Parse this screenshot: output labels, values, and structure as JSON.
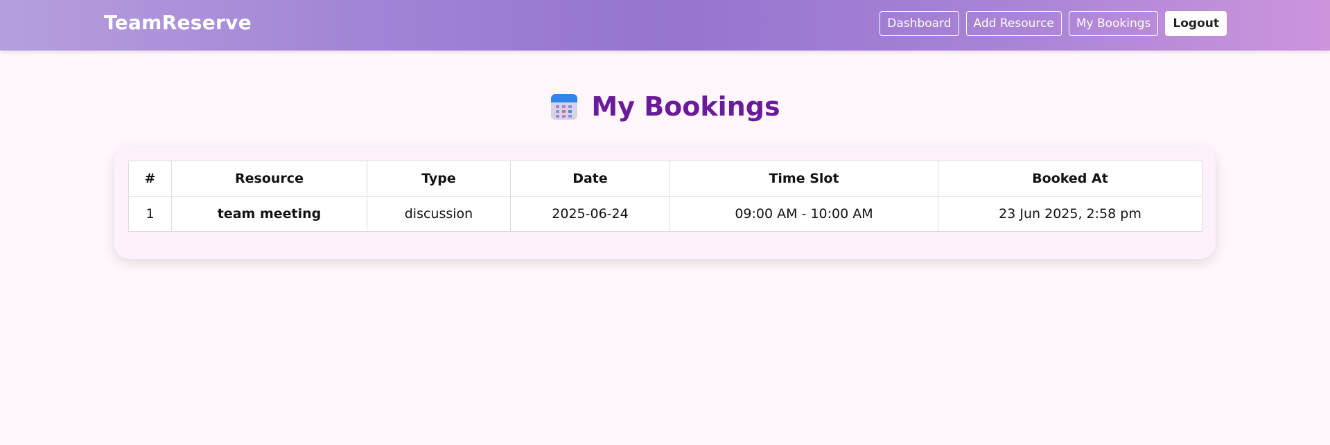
{
  "navbar": {
    "brand": "TeamReserve",
    "links": [
      {
        "label": "Dashboard"
      },
      {
        "label": "Add Resource"
      },
      {
        "label": "My Bookings"
      },
      {
        "label": "Logout"
      }
    ],
    "gradient_colors": [
      "#b59fdc",
      "#9575cd",
      "#cc95dc"
    ]
  },
  "page": {
    "title": "My Bookings",
    "title_icon": "calendar-icon",
    "title_color": "#6a1b9a",
    "background": "#fff7fb"
  },
  "bookings_table": {
    "headers": [
      "#",
      "Resource",
      "Type",
      "Date",
      "Time Slot",
      "Booked At"
    ],
    "rows": [
      {
        "index": "1",
        "resource": "team meeting",
        "type": "discussion",
        "date": "2025-06-24",
        "time_slot": "09:00 AM - 10:00 AM",
        "booked_at": "23 Jun 2025, 2:58 pm"
      }
    ]
  }
}
